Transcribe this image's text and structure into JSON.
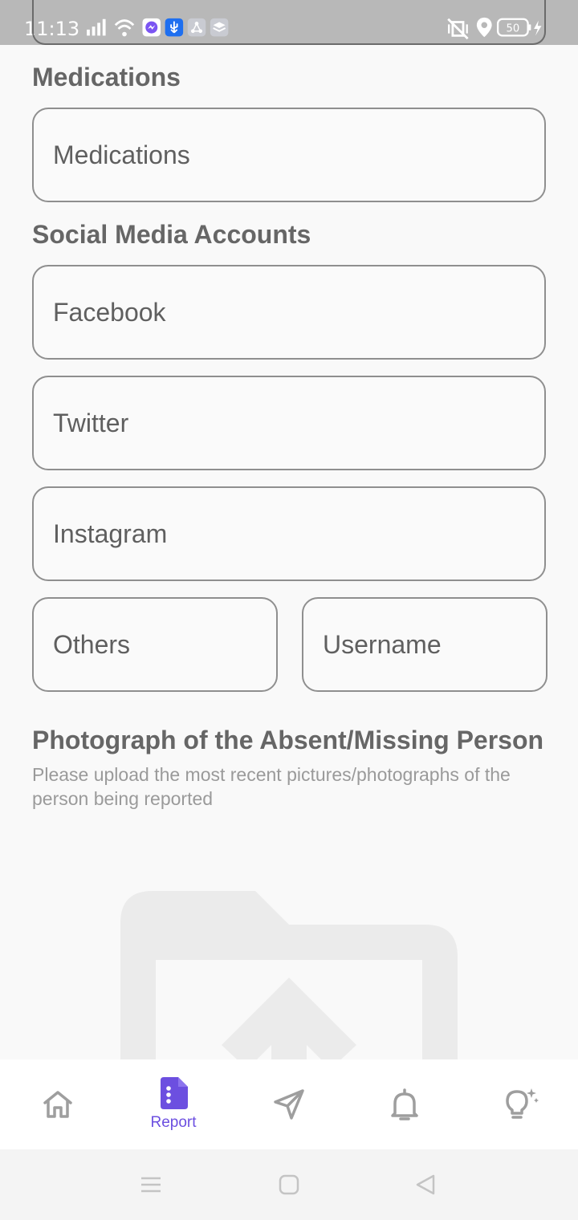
{
  "status_bar": {
    "time": "11:13",
    "battery": "50"
  },
  "form": {
    "medications_heading": "Medications",
    "medications_placeholder": "Medications",
    "social_heading": "Social Media Accounts",
    "facebook_placeholder": "Facebook",
    "twitter_placeholder": "Twitter",
    "instagram_placeholder": "Instagram",
    "others_placeholder": "Others",
    "username_placeholder": "Username",
    "photo_heading": "Photograph of the Absent/Missing Person",
    "photo_subtitle": "Please upload the most recent pictures/photographs of the person being reported"
  },
  "bottom_nav": {
    "items": [
      {
        "icon": "home-icon",
        "label": ""
      },
      {
        "icon": "report-icon",
        "label": "Report",
        "active": true
      },
      {
        "icon": "send-icon",
        "label": ""
      },
      {
        "icon": "bell-icon",
        "label": ""
      },
      {
        "icon": "lightbulb-icon",
        "label": ""
      }
    ]
  },
  "colors": {
    "accent": "#6c4fe0",
    "status_bar": "#b8b8b8",
    "field_border": "#8f8f8f"
  }
}
